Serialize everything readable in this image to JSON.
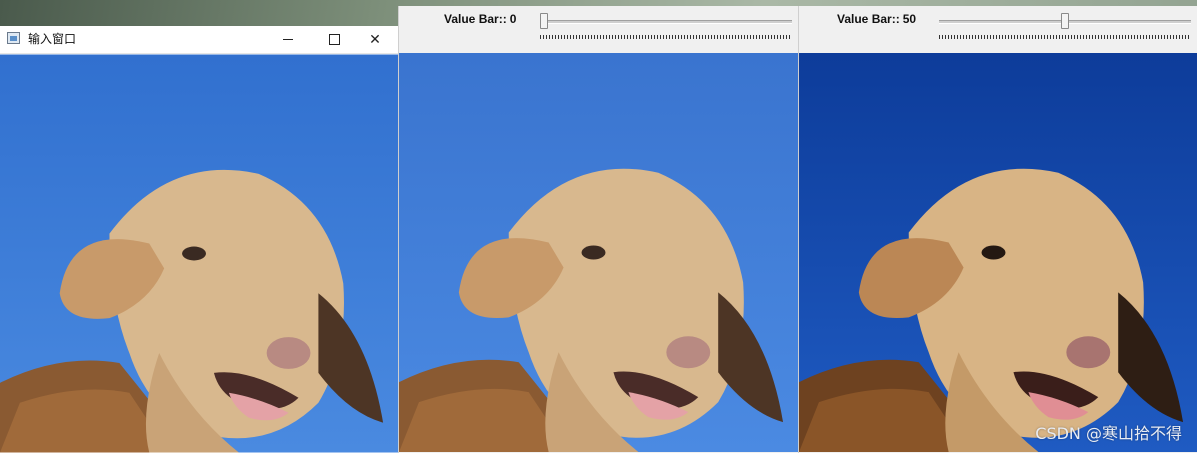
{
  "window1": {
    "title": "输入窗口",
    "icon": "opencv-window-icon",
    "controls": [
      "minimize-icon",
      "maximize-icon",
      "close-icon"
    ],
    "close_glyph": "✕"
  },
  "window2": {
    "trackbar": {
      "label": "Value Bar::",
      "value": "0",
      "min": 0,
      "max": 100,
      "level": 0
    }
  },
  "window3": {
    "trackbar": {
      "label": "Value Bar::",
      "value": "50",
      "min": 0,
      "max": 100,
      "level": 0.5
    }
  },
  "watermark": "CSDN @寒山拾不得",
  "colors": {
    "sky_original": "#3f7fd6",
    "sky_dark": "#1448a8",
    "sheep_wool": "#d9bb94",
    "sheep_brown": "#9a6a3e"
  }
}
